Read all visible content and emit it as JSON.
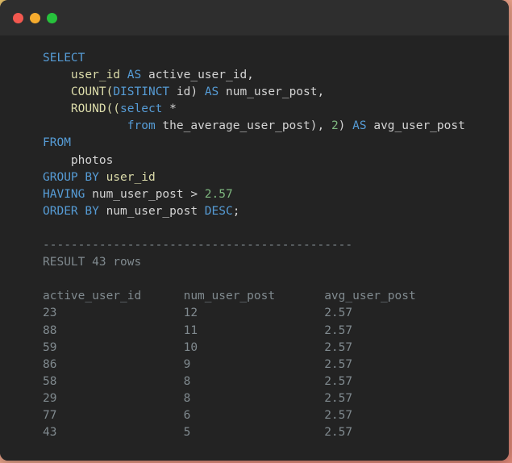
{
  "window": {
    "title": "",
    "traffic_lights": [
      {
        "name": "close",
        "color": "#f2584f"
      },
      {
        "name": "minimize",
        "color": "#f5ab2e"
      },
      {
        "name": "maximize",
        "color": "#27c23c"
      }
    ],
    "background": "#232323",
    "titlebar_background": "#2e2e2e"
  },
  "colors": {
    "keyword": "#569cd6",
    "function": "#dcdcaa",
    "plain": "#d4d4d4",
    "number": "#7eb77f",
    "output": "#808a8f"
  },
  "query": {
    "lines": [
      {
        "id": "line-select",
        "tokens": [
          {
            "t": "SELECT",
            "c": "kw"
          }
        ]
      },
      {
        "id": "line-user-id",
        "tokens": [
          {
            "t": "    ",
            "c": "plain"
          },
          {
            "t": "user_id",
            "c": "fn"
          },
          {
            "t": " ",
            "c": "plain"
          },
          {
            "t": "AS",
            "c": "kw"
          },
          {
            "t": " active_user_id,",
            "c": "plain"
          }
        ]
      },
      {
        "id": "line-count",
        "tokens": [
          {
            "t": "    ",
            "c": "plain"
          },
          {
            "t": "COUNT(",
            "c": "fn"
          },
          {
            "t": "DISTINCT",
            "c": "kw"
          },
          {
            "t": " id) ",
            "c": "plain"
          },
          {
            "t": "AS",
            "c": "kw"
          },
          {
            "t": " num_user_post,",
            "c": "plain"
          }
        ]
      },
      {
        "id": "line-round",
        "tokens": [
          {
            "t": "    ",
            "c": "plain"
          },
          {
            "t": "ROUND((",
            "c": "fn"
          },
          {
            "t": "select",
            "c": "kw"
          },
          {
            "t": " *",
            "c": "plain"
          }
        ]
      },
      {
        "id": "line-subfrom",
        "tokens": [
          {
            "t": "            ",
            "c": "plain"
          },
          {
            "t": "from",
            "c": "kw"
          },
          {
            "t": " the_average_user_post), ",
            "c": "plain"
          },
          {
            "t": "2",
            "c": "num"
          },
          {
            "t": ") ",
            "c": "plain"
          },
          {
            "t": "AS",
            "c": "kw"
          },
          {
            "t": " avg_user_post",
            "c": "plain"
          }
        ]
      },
      {
        "id": "line-from",
        "tokens": [
          {
            "t": "FROM",
            "c": "kw"
          }
        ]
      },
      {
        "id": "line-photos",
        "tokens": [
          {
            "t": "    photos",
            "c": "plain"
          }
        ]
      },
      {
        "id": "line-groupby",
        "tokens": [
          {
            "t": "GROUP BY",
            "c": "kw"
          },
          {
            "t": " ",
            "c": "plain"
          },
          {
            "t": "user_id",
            "c": "fn"
          }
        ]
      },
      {
        "id": "line-having",
        "tokens": [
          {
            "t": "HAVING",
            "c": "kw"
          },
          {
            "t": " num_user_post > ",
            "c": "plain"
          },
          {
            "t": "2.57",
            "c": "num"
          }
        ]
      },
      {
        "id": "line-orderby",
        "tokens": [
          {
            "t": "ORDER BY",
            "c": "kw"
          },
          {
            "t": " num_user_post ",
            "c": "plain"
          },
          {
            "t": "DESC",
            "c": "kw"
          },
          {
            "t": ";",
            "c": "plain"
          }
        ]
      }
    ]
  },
  "result": {
    "separator": "--------------------------------------------",
    "status": "RESULT 43 rows",
    "columns": [
      "active_user_id",
      "num_user_post",
      "avg_user_post"
    ],
    "rows": [
      [
        "23",
        "12",
        "2.57"
      ],
      [
        "88",
        "11",
        "2.57"
      ],
      [
        "59",
        "10",
        "2.57"
      ],
      [
        "86",
        "9",
        "2.57"
      ],
      [
        "58",
        "8",
        "2.57"
      ],
      [
        "29",
        "8",
        "2.57"
      ],
      [
        "77",
        "6",
        "2.57"
      ],
      [
        "43",
        "5",
        "2.57"
      ]
    ]
  }
}
